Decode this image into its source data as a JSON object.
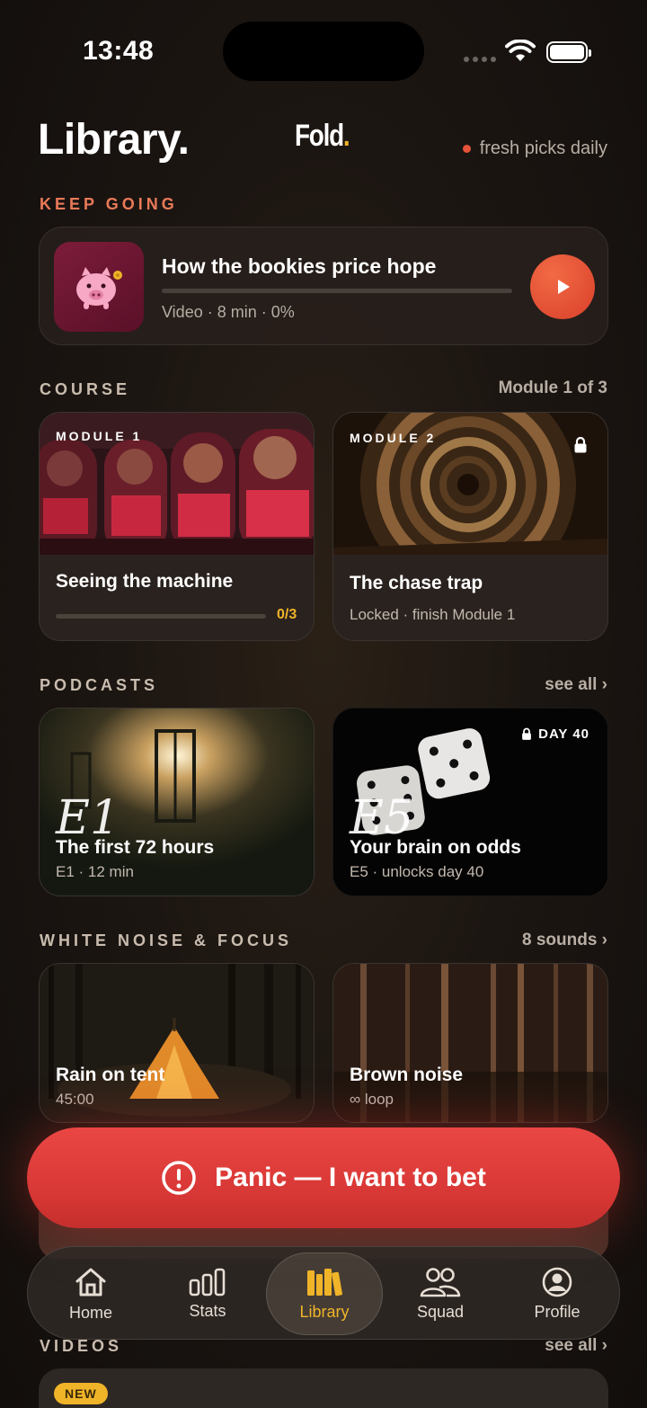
{
  "status": {
    "time": "13:48"
  },
  "header": {
    "title": "Library.",
    "brand": "Fold",
    "brand_dot": ".",
    "tagline": "fresh picks daily"
  },
  "keep_going": {
    "label": "KEEP GOING",
    "item": {
      "title": "How the bookies price hope",
      "meta": "Video · 8 min · 0%",
      "progress": 0
    }
  },
  "course": {
    "label": "COURSE",
    "link": "Module 1 of 3",
    "modules": [
      {
        "tag": "MODULE 1",
        "title": "Seeing the machine",
        "progress_text": "0/3",
        "progress": 0
      },
      {
        "tag": "MODULE 2",
        "title": "The chase trap",
        "sub": "Locked · finish Module 1",
        "locked": true
      }
    ]
  },
  "podcasts": {
    "label": "PODCASTS",
    "link": "see all ›",
    "items": [
      {
        "ep": "E1",
        "title": "The first 72 hours",
        "sub": "E1 · 12 min"
      },
      {
        "ep": "E5",
        "title": "Your brain on odds",
        "sub": "E5 · unlocks day 40",
        "badge": "DAY 40"
      }
    ]
  },
  "white_noise": {
    "label": "WHITE NOISE & FOCUS",
    "link": "8 sounds ›",
    "items": [
      {
        "title": "Rain on tent",
        "sub": "45:00"
      },
      {
        "title": "Brown noise",
        "sub": "∞ loop"
      }
    ]
  },
  "panic": {
    "label": "Panic — I want to bet"
  },
  "videos": {
    "label": "VIDEOS",
    "link": "see all ›",
    "badge": "NEW"
  },
  "tabs": [
    {
      "label": "Home",
      "icon": "home-icon"
    },
    {
      "label": "Stats",
      "icon": "stats-icon"
    },
    {
      "label": "Library",
      "icon": "library-icon",
      "active": true
    },
    {
      "label": "Squad",
      "icon": "squad-icon"
    },
    {
      "label": "Profile",
      "icon": "profile-icon"
    }
  ],
  "colors": {
    "accent": "#f0b429",
    "panic": "#e04240",
    "play": "#e5533a",
    "section_accent": "#ea7a58"
  }
}
